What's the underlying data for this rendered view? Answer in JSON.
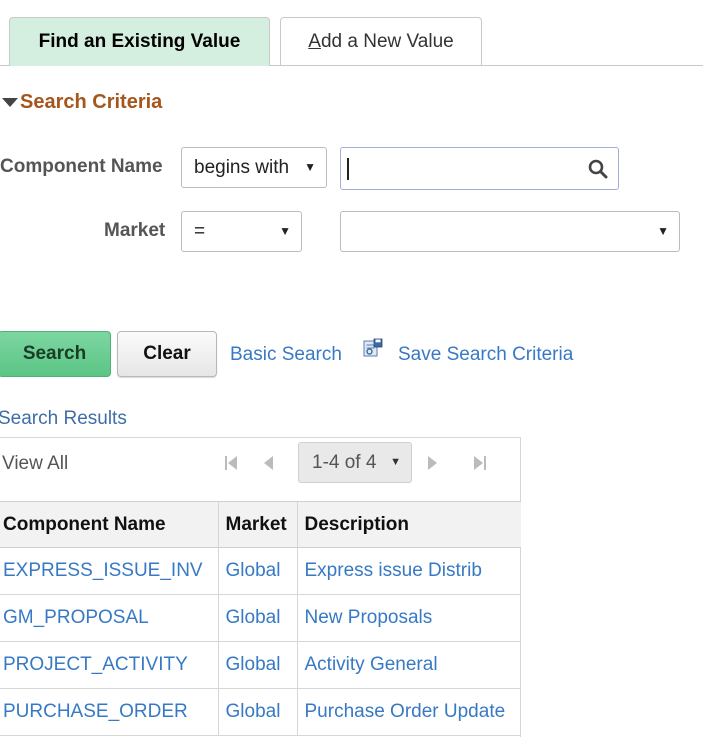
{
  "tabs": {
    "find_existing": "Find an Existing Value",
    "add_new_underlined": "A",
    "add_new_rest": "dd a New Value"
  },
  "search_criteria": {
    "title": "Search Criteria",
    "component_name": {
      "label": "Component Name",
      "operator": "begins with",
      "value": ""
    },
    "market": {
      "label": "Market",
      "operator": "=",
      "value": ""
    }
  },
  "buttons": {
    "search": "Search",
    "clear": "Clear",
    "basic_search": "Basic Search",
    "save_search_criteria": "Save Search Criteria"
  },
  "results": {
    "title": "Search Results",
    "view_all": "View All",
    "pager": "1-4 of 4",
    "columns": [
      "Component Name",
      "Market",
      "Description"
    ],
    "rows": [
      {
        "component": "EXPRESS_ISSUE_INV",
        "market": "Global",
        "description": "Express issue Distrib"
      },
      {
        "component": "GM_PROPOSAL",
        "market": "Global",
        "description": "New Proposals"
      },
      {
        "component": "PROJECT_ACTIVITY",
        "market": "Global",
        "description": "Activity General"
      },
      {
        "component": "PURCHASE_ORDER",
        "market": "Global",
        "description": "Purchase Order Update"
      }
    ]
  },
  "colors": {
    "active_tab_bg": "#d4efdf",
    "section_title": "#a4561b",
    "link": "#3779c4",
    "search_button": "#5bc585"
  },
  "icons": {
    "collapse": "triangle-down-icon",
    "search": "magnifier-icon",
    "save": "save-search-icon",
    "first": "first-page-icon",
    "prev": "previous-page-icon",
    "next": "next-page-icon",
    "last": "last-page-icon"
  }
}
